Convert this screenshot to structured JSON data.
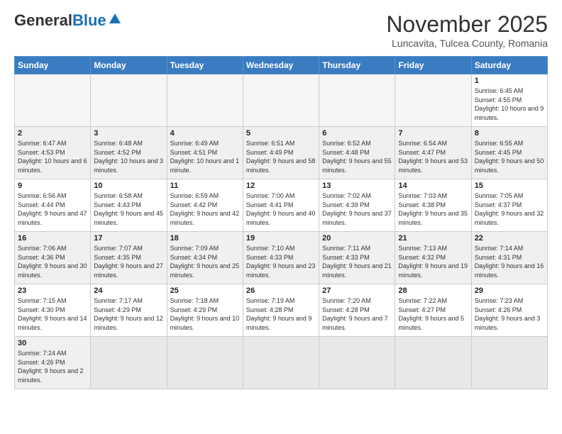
{
  "header": {
    "logo_general": "General",
    "logo_blue": "Blue",
    "month_title": "November 2025",
    "location": "Luncavita, Tulcea County, Romania"
  },
  "days_of_week": [
    "Sunday",
    "Monday",
    "Tuesday",
    "Wednesday",
    "Thursday",
    "Friday",
    "Saturday"
  ],
  "weeks": [
    [
      {
        "day": "",
        "info": ""
      },
      {
        "day": "",
        "info": ""
      },
      {
        "day": "",
        "info": ""
      },
      {
        "day": "",
        "info": ""
      },
      {
        "day": "",
        "info": ""
      },
      {
        "day": "",
        "info": ""
      },
      {
        "day": "1",
        "info": "Sunrise: 6:45 AM\nSunset: 4:55 PM\nDaylight: 10 hours and 9 minutes."
      }
    ],
    [
      {
        "day": "2",
        "info": "Sunrise: 6:47 AM\nSunset: 4:53 PM\nDaylight: 10 hours and 6 minutes."
      },
      {
        "day": "3",
        "info": "Sunrise: 6:48 AM\nSunset: 4:52 PM\nDaylight: 10 hours and 3 minutes."
      },
      {
        "day": "4",
        "info": "Sunrise: 6:49 AM\nSunset: 4:51 PM\nDaylight: 10 hours and 1 minute."
      },
      {
        "day": "5",
        "info": "Sunrise: 6:51 AM\nSunset: 4:49 PM\nDaylight: 9 hours and 58 minutes."
      },
      {
        "day": "6",
        "info": "Sunrise: 6:52 AM\nSunset: 4:48 PM\nDaylight: 9 hours and 55 minutes."
      },
      {
        "day": "7",
        "info": "Sunrise: 6:54 AM\nSunset: 4:47 PM\nDaylight: 9 hours and 53 minutes."
      },
      {
        "day": "8",
        "info": "Sunrise: 6:55 AM\nSunset: 4:45 PM\nDaylight: 9 hours and 50 minutes."
      }
    ],
    [
      {
        "day": "9",
        "info": "Sunrise: 6:56 AM\nSunset: 4:44 PM\nDaylight: 9 hours and 47 minutes."
      },
      {
        "day": "10",
        "info": "Sunrise: 6:58 AM\nSunset: 4:43 PM\nDaylight: 9 hours and 45 minutes."
      },
      {
        "day": "11",
        "info": "Sunrise: 6:59 AM\nSunset: 4:42 PM\nDaylight: 9 hours and 42 minutes."
      },
      {
        "day": "12",
        "info": "Sunrise: 7:00 AM\nSunset: 4:41 PM\nDaylight: 9 hours and 40 minutes."
      },
      {
        "day": "13",
        "info": "Sunrise: 7:02 AM\nSunset: 4:39 PM\nDaylight: 9 hours and 37 minutes."
      },
      {
        "day": "14",
        "info": "Sunrise: 7:03 AM\nSunset: 4:38 PM\nDaylight: 9 hours and 35 minutes."
      },
      {
        "day": "15",
        "info": "Sunrise: 7:05 AM\nSunset: 4:37 PM\nDaylight: 9 hours and 32 minutes."
      }
    ],
    [
      {
        "day": "16",
        "info": "Sunrise: 7:06 AM\nSunset: 4:36 PM\nDaylight: 9 hours and 30 minutes."
      },
      {
        "day": "17",
        "info": "Sunrise: 7:07 AM\nSunset: 4:35 PM\nDaylight: 9 hours and 27 minutes."
      },
      {
        "day": "18",
        "info": "Sunrise: 7:09 AM\nSunset: 4:34 PM\nDaylight: 9 hours and 25 minutes."
      },
      {
        "day": "19",
        "info": "Sunrise: 7:10 AM\nSunset: 4:33 PM\nDaylight: 9 hours and 23 minutes."
      },
      {
        "day": "20",
        "info": "Sunrise: 7:11 AM\nSunset: 4:33 PM\nDaylight: 9 hours and 21 minutes."
      },
      {
        "day": "21",
        "info": "Sunrise: 7:13 AM\nSunset: 4:32 PM\nDaylight: 9 hours and 19 minutes."
      },
      {
        "day": "22",
        "info": "Sunrise: 7:14 AM\nSunset: 4:31 PM\nDaylight: 9 hours and 16 minutes."
      }
    ],
    [
      {
        "day": "23",
        "info": "Sunrise: 7:15 AM\nSunset: 4:30 PM\nDaylight: 9 hours and 14 minutes."
      },
      {
        "day": "24",
        "info": "Sunrise: 7:17 AM\nSunset: 4:29 PM\nDaylight: 9 hours and 12 minutes."
      },
      {
        "day": "25",
        "info": "Sunrise: 7:18 AM\nSunset: 4:29 PM\nDaylight: 9 hours and 10 minutes."
      },
      {
        "day": "26",
        "info": "Sunrise: 7:19 AM\nSunset: 4:28 PM\nDaylight: 9 hours and 9 minutes."
      },
      {
        "day": "27",
        "info": "Sunrise: 7:20 AM\nSunset: 4:28 PM\nDaylight: 9 hours and 7 minutes."
      },
      {
        "day": "28",
        "info": "Sunrise: 7:22 AM\nSunset: 4:27 PM\nDaylight: 9 hours and 5 minutes."
      },
      {
        "day": "29",
        "info": "Sunrise: 7:23 AM\nSunset: 4:26 PM\nDaylight: 9 hours and 3 minutes."
      }
    ],
    [
      {
        "day": "30",
        "info": "Sunrise: 7:24 AM\nSunset: 4:26 PM\nDaylight: 9 hours and 2 minutes."
      },
      {
        "day": "",
        "info": ""
      },
      {
        "day": "",
        "info": ""
      },
      {
        "day": "",
        "info": ""
      },
      {
        "day": "",
        "info": ""
      },
      {
        "day": "",
        "info": ""
      },
      {
        "day": "",
        "info": ""
      }
    ]
  ]
}
